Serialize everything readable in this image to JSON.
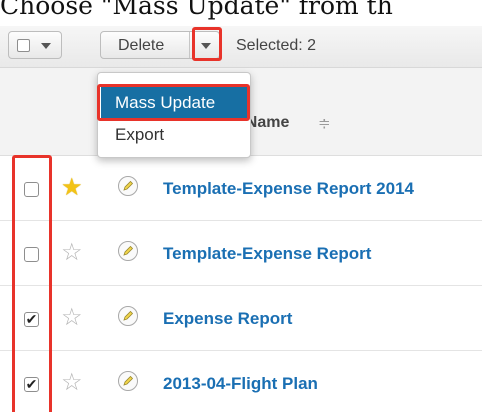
{
  "caption": "Choose \"Mass Update\" from th",
  "toolbar": {
    "delete_label": "Delete",
    "selected_text": "Selected: 2"
  },
  "header": {
    "column_label": "t Name",
    "sort_glyph": "≑"
  },
  "dropdown": {
    "items": [
      {
        "label": "Mass Update",
        "active": true
      },
      {
        "label": "Export",
        "active": false
      }
    ]
  },
  "rows": [
    {
      "checked": false,
      "favorite": true,
      "name": "Template-Expense Report 2014"
    },
    {
      "checked": false,
      "favorite": false,
      "name": "Template-Expense Report"
    },
    {
      "checked": true,
      "favorite": false,
      "name": "Expense Report"
    },
    {
      "checked": true,
      "favorite": false,
      "name": "2013-04-Flight Plan"
    }
  ],
  "colors": {
    "highlight_box": "#e8332a",
    "menu_active_bg": "#176fa3",
    "link_blue": "#1a6fb3",
    "star_gold": "#f3c316"
  },
  "icons": {
    "favorite_on": "star-filled-icon",
    "favorite_off": "star-outline-icon",
    "preview": "pencil-icon"
  }
}
